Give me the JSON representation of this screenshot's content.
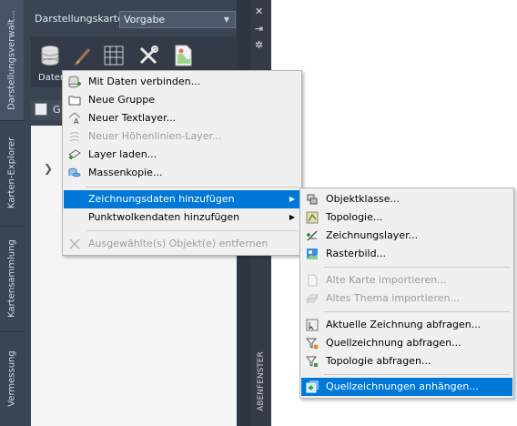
{
  "tabs": [
    {
      "label": "Darstellungsverwalt..."
    },
    {
      "label": "Karten-Explorer"
    },
    {
      "label": "Kartensammlung"
    },
    {
      "label": "Vermessung"
    }
  ],
  "palette": {
    "map_label": "Darstellungskarte:",
    "map_value": "Vorgabe",
    "daten_label": "Daten",
    "subbar_text": "G",
    "side_label": "ABENFENSTER",
    "close_glyph": "✕",
    "pin_glyph": "⇥",
    "settings_glyph": "✲"
  },
  "menu1": {
    "items": [
      {
        "label": "Mit Daten verbinden...",
        "icon": "database-connect-icon",
        "disabled": false
      },
      {
        "label": "Neue Gruppe",
        "icon": "folder-icon",
        "disabled": false
      },
      {
        "label": "Neuer Textlayer...",
        "icon": "text-layer-icon",
        "disabled": false
      },
      {
        "label": "Neuer Höhenlinien-Layer...",
        "icon": "contour-layer-icon",
        "disabled": true
      },
      {
        "label": "Layer laden...",
        "icon": "layer-load-icon",
        "disabled": false
      },
      {
        "label": "Massenkopie...",
        "icon": "bulk-copy-icon",
        "disabled": false
      },
      {
        "label": "Zeichnungsdaten hinzufügen",
        "icon": "",
        "disabled": false,
        "submenu": true,
        "highlighted": true
      },
      {
        "label": "Punktwolkendaten hinzufügen",
        "icon": "",
        "disabled": false,
        "submenu": true
      },
      {
        "label": "Ausgewählte(s) Objekt(e) entfernen",
        "icon": "remove-icon",
        "disabled": true
      }
    ]
  },
  "menu2": {
    "items": [
      {
        "label": "Objektklasse...",
        "icon": "feature-class-icon",
        "disabled": false
      },
      {
        "label": "Topologie...",
        "icon": "topology-icon",
        "disabled": false
      },
      {
        "label": "Zeichnungslayer...",
        "icon": "drawing-layer-icon",
        "disabled": false
      },
      {
        "label": "Rasterbild...",
        "icon": "raster-image-icon",
        "disabled": false
      },
      {
        "label": "Alte Karte importieren...",
        "icon": "old-map-icon",
        "disabled": true
      },
      {
        "label": "Altes Thema importieren...",
        "icon": "old-theme-icon",
        "disabled": true
      },
      {
        "label": "Aktuelle Zeichnung abfragen...",
        "icon": "query-current-icon",
        "disabled": false
      },
      {
        "label": "Quellzeichnung abfragen...",
        "icon": "query-source-icon",
        "disabled": false
      },
      {
        "label": "Topologie abfragen...",
        "icon": "query-topology-icon",
        "disabled": false
      },
      {
        "label": "Quellzeichnungen anhängen...",
        "icon": "attach-drawings-icon",
        "disabled": false,
        "highlighted": true
      }
    ]
  },
  "colors": {
    "highlight": "#0078d7",
    "panel_dark": "#3b4453"
  }
}
